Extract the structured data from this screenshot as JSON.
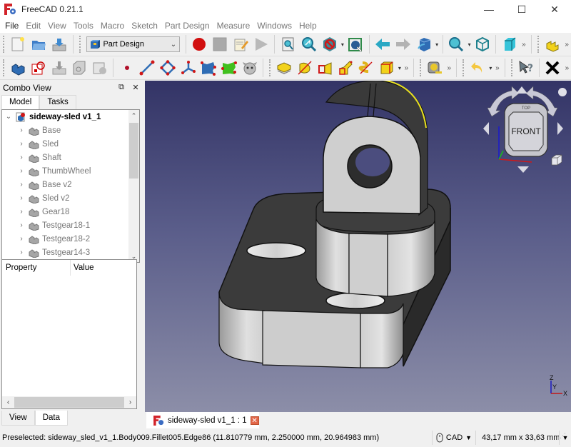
{
  "window": {
    "title": "FreeCAD 0.21.1",
    "controls": {
      "minimize": "—",
      "maximize": "☐",
      "close": "✕"
    }
  },
  "menubar": {
    "items": [
      "File",
      "Edit",
      "View",
      "Tools",
      "Macro",
      "Sketch",
      "Part Design",
      "Measure",
      "Windows",
      "Help"
    ]
  },
  "toolbar": {
    "workbench_selector": {
      "value": "Part Design"
    },
    "row1_icons": [
      "new-document",
      "open-document",
      "save-document",
      "macro-record",
      "macro-stop",
      "macro-edit",
      "macro-execute",
      "fit-all",
      "fit-selection",
      "draw-style",
      "bounding-box",
      "nav-back",
      "nav-forward",
      "view-isometric",
      "zoom",
      "view-axonometric",
      "view-box",
      "create-body"
    ],
    "row2_icons": [
      "body",
      "new-sketch",
      "validate-sketch",
      "clone",
      "shape-binder",
      "datum-point",
      "datum-line",
      "datum-plane",
      "local-coordinate-system",
      "shape-binder-blue",
      "subshape-binder",
      "clone-object",
      "pad",
      "revolution",
      "loft",
      "sweep",
      "helix",
      "additive-box",
      "measure",
      "undo",
      "whats-this",
      "close-x"
    ],
    "more_glyph": "»"
  },
  "combo_view": {
    "title": "Combo View",
    "tabs": [
      "Model",
      "Tasks"
    ],
    "active_tab": "Model",
    "tree": {
      "root": "sideway-sled v1_1",
      "children": [
        "Base",
        "Sled",
        "Shaft",
        "ThumbWheel",
        "Base v2",
        "Sled v2",
        "Gear18",
        "Testgear18-1",
        "Testgear18-2",
        "Testgear14-3"
      ]
    },
    "property_table": {
      "columns": [
        "Property",
        "Value"
      ]
    },
    "bottom_tabs": [
      "View",
      "Data"
    ],
    "active_bottom_tab": "Data"
  },
  "viewport": {
    "navcube": {
      "face_front": "FRONT",
      "face_top": "TOP"
    },
    "axis_labels": {
      "x": "X",
      "y": "Y",
      "z": "Z"
    },
    "colors": {
      "bg_top": "#333466",
      "bg_bottom": "#8c8ea8",
      "model_face_light": "#cfcfcf",
      "model_face_dark": "#3c3c3c",
      "preselect_highlight": "#e8e020"
    }
  },
  "document_tab": {
    "label": "sideway-sled v1_1 : 1",
    "close_glyph": "✕"
  },
  "statusbar": {
    "message": "Preselected: sideway_sled_v1_1.Body009.Fillet005.Edge86 (11.810779 mm, 2.250000 mm, 20.964983 mm)",
    "navigation_style": "CAD",
    "dimensions": "43,17 mm x 33,63 mm"
  }
}
